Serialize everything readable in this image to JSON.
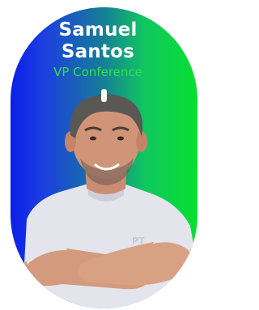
{
  "speaker": {
    "first_name": "Samuel",
    "last_name": "Santos",
    "role": "VP Conference"
  },
  "colors": {
    "gradient_left": "#0b1fe9",
    "gradient_right": "#06e02e",
    "name_text": "#ffffff",
    "role_text": "#2fe24b"
  },
  "icons": {
    "pin": "lanyard-pin-icon"
  }
}
